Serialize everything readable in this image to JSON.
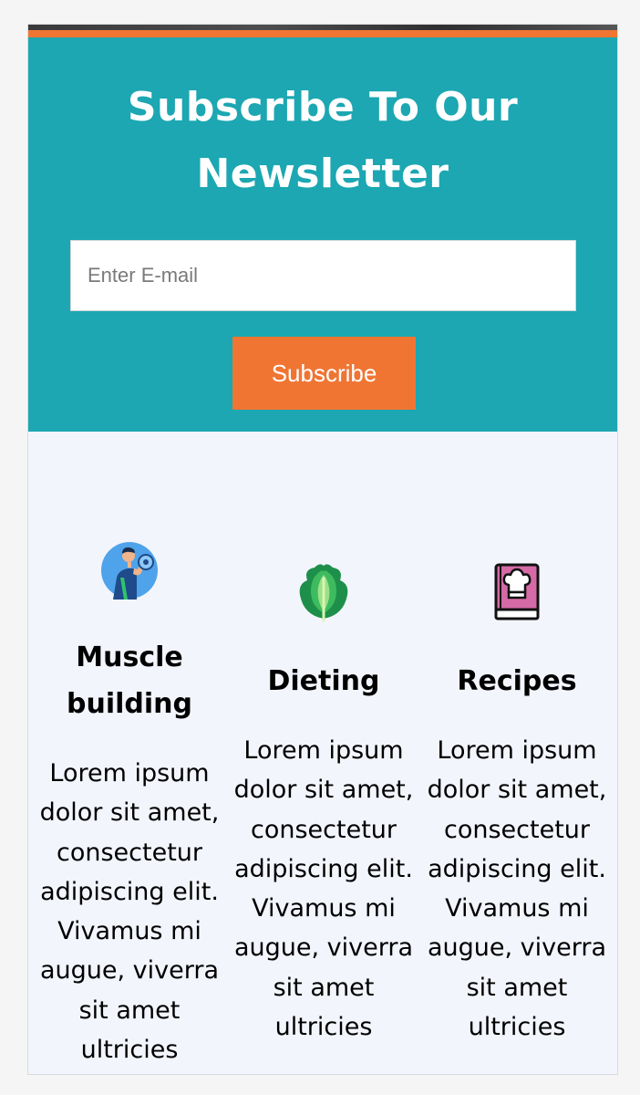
{
  "newsletter": {
    "title_line1": "Subscribe To Our",
    "title_line2": "Newsletter",
    "email_placeholder": "Enter E-mail",
    "subscribe_label": "Subscribe"
  },
  "features": [
    {
      "title_line1": "Muscle",
      "title_line2": "building",
      "icon": "bodybuilder-dumbbell-icon",
      "text": "Lorem ipsum dolor sit amet, consectetur adipiscing elit. Vivamus mi augue, viverra sit amet ultricies"
    },
    {
      "title": "Dieting",
      "icon": "lettuce-leaf-icon",
      "text": "Lorem ipsum dolor sit amet, consectetur adipiscing elit. Vivamus mi augue, viverra sit amet ultricies"
    },
    {
      "title": "Recipes",
      "icon": "recipe-book-chef-hat-icon",
      "text": "Lorem ipsum dolor sit amet, consectetur adipiscing elit. Vivamus mi augue, viverra sit amet ultricies"
    }
  ],
  "colors": {
    "teal": "#1ca7b2",
    "orange": "#f07533",
    "section_bg": "#f3f5fd"
  }
}
